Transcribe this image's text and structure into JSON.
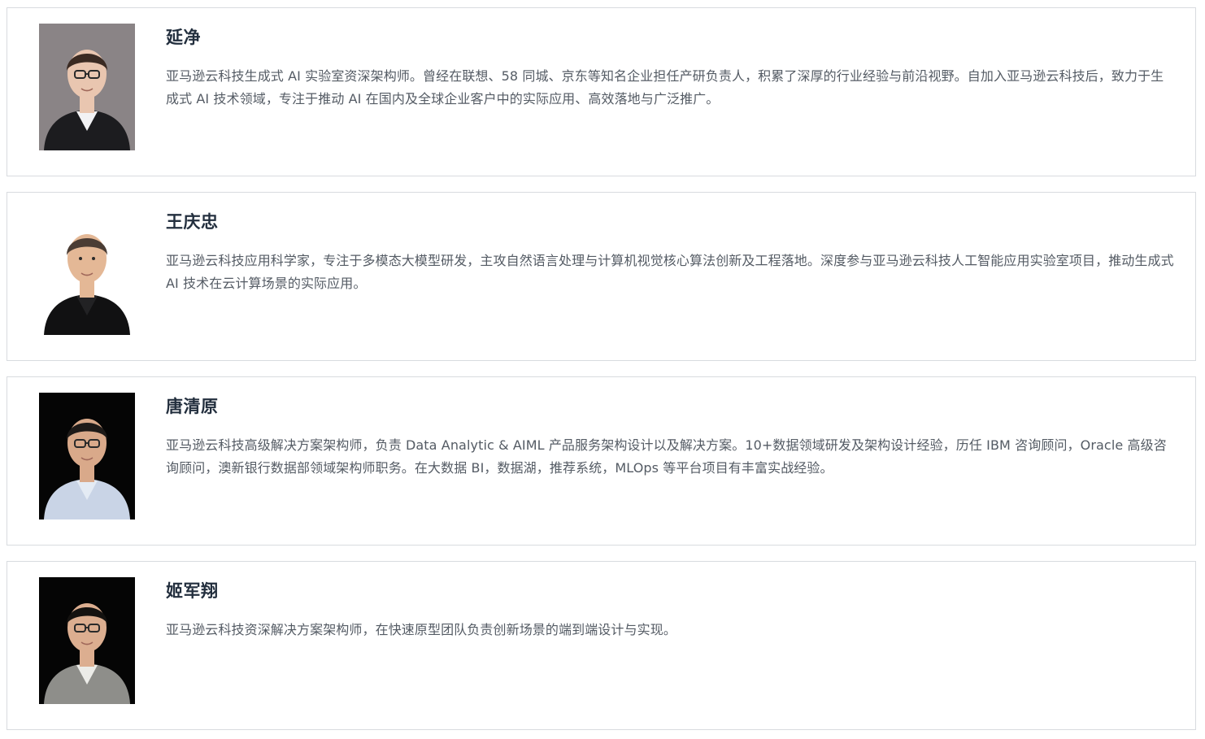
{
  "speakers": [
    {
      "name": "延净",
      "bio": "亚马逊云科技生成式 AI 实验室资深架构师。曾经在联想、58 同城、京东等知名企业担任产研负责人，积累了深厚的行业经验与前沿视野。自加入亚马逊云科技后，致力于生成式 AI 技术领域，专注于推动 AI 在国内及全球企业客户中的实际应用、高效落地与广泛推广。",
      "photo": {
        "bg": "#8a8486",
        "hair": "#3a2a22",
        "skin": "#e9c6b0",
        "clothes": "#1c1c1f",
        "collar": "#f2f2f4",
        "glasses": true
      }
    },
    {
      "name": "王庆忠",
      "bio": "亚马逊云科技应用科学家，专注于多模态大模型研发，主攻自然语言处理与计算机视觉核心算法创新及工程落地。深度参与亚马逊云科技人工智能应用实验室项目，推动生成式 AI 技术在云计算场景的实际应用。",
      "photo": {
        "bg": "#ffffff",
        "hair": "#4a3c34",
        "skin": "#e4b896",
        "clothes": "#111112",
        "collar": "#222224",
        "glasses": false
      }
    },
    {
      "name": "唐清原",
      "bio": "亚马逊云科技高级解决方案架构师，负责 Data Analytic & AIML 产品服务架构设计以及解决方案。10+数据领域研发及架构设计经验，历任 IBM 咨询顾问，Oracle 高级咨询顾问，澳新银行数据部领域架构师职务。在大数据 BI，数据湖，推荐系统，MLOps 等平台项目有丰富实战经验。",
      "photo": {
        "bg": "#050505",
        "hair": "#1e1a18",
        "skin": "#d9a98a",
        "clothes": "#c9d4e6",
        "collar": "#e4ebf4",
        "glasses": true
      }
    },
    {
      "name": "姬军翔",
      "bio": "亚马逊云科技资深解决方案架构师，在快速原型团队负责创新场景的端到端设计与实现。",
      "photo": {
        "bg": "#050505",
        "hair": "#141210",
        "skin": "#dcae90",
        "clothes": "#8e8e8a",
        "collar": "#ecece8",
        "glasses": true
      }
    }
  ]
}
